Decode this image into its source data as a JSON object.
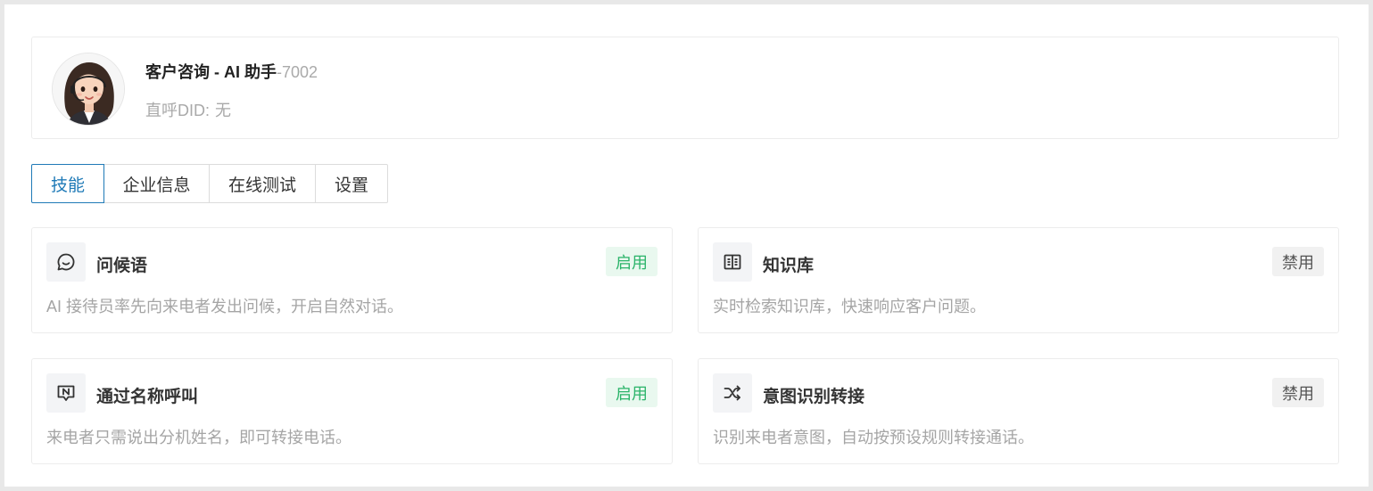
{
  "agent": {
    "name": "客户咨询 - AI 助手",
    "extension": "-7002",
    "did_label": "直呼DID:",
    "did_value": "无"
  },
  "tabs": [
    {
      "label": "技能",
      "active": true
    },
    {
      "label": "企业信息",
      "active": false
    },
    {
      "label": "在线测试",
      "active": false
    },
    {
      "label": "设置",
      "active": false
    }
  ],
  "skills": [
    {
      "icon": "chat-smile-icon",
      "title": "问候语",
      "status": "启用",
      "enabled": true,
      "description": "AI 接待员率先向来电者发出问候，开启自然对话。"
    },
    {
      "icon": "book-open-icon",
      "title": "知识库",
      "status": "禁用",
      "enabled": false,
      "description": "实时检索知识库，快速响应客户问题。"
    },
    {
      "icon": "name-call-icon",
      "title": "通过名称呼叫",
      "status": "启用",
      "enabled": true,
      "description": "来电者只需说出分机姓名，即可转接电话。"
    },
    {
      "icon": "shuffle-icon",
      "title": "意图识别转接",
      "status": "禁用",
      "enabled": false,
      "description": "识别来电者意图，自动按预设规则转接通话。"
    }
  ],
  "colors": {
    "accent": "#1f7ab7",
    "enabled_text": "#2bb46a",
    "enabled_bg": "#e9f8ef",
    "disabled_bg": "#f1f1f1"
  }
}
